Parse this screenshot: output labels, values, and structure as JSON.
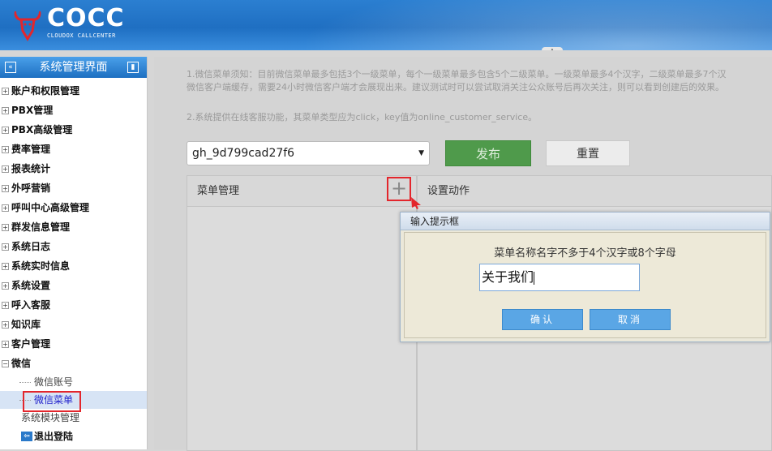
{
  "brand": {
    "logo_text": "COCC",
    "logo_sub": "CLOUDOX CALLCENTER"
  },
  "sidebar": {
    "title": "系统管理界面",
    "items": [
      {
        "label": "账户和权限管理"
      },
      {
        "label": "PBX管理"
      },
      {
        "label": "PBX高级管理"
      },
      {
        "label": "费率管理"
      },
      {
        "label": "报表统计"
      },
      {
        "label": "外呼营销"
      },
      {
        "label": "呼叫中心高级管理"
      },
      {
        "label": "群发信息管理"
      },
      {
        "label": "系统日志"
      },
      {
        "label": "系统实时信息"
      },
      {
        "label": "系统设置"
      },
      {
        "label": "呼入客服"
      },
      {
        "label": "知识库"
      },
      {
        "label": "客户管理"
      },
      {
        "label": "微信"
      }
    ],
    "wechat_children": [
      {
        "label": "微信账号"
      },
      {
        "label": "微信菜单"
      }
    ],
    "extra": "系统模块管理",
    "logout": "退出登陆"
  },
  "main": {
    "note1_line1": "1.微信菜单须知：目前微信菜单最多包括3个一级菜单，每个一级菜单最多包含5个二级菜单。一级菜单最多4个汉字，二级菜单最多7个汉",
    "note1_line2": "微信客户端缓存，需要24小时微信客户端才会展现出来。建议测试时可以尝试取消关注公众账号后再次关注，则可以看到创建后的效果。",
    "note2": "2.系统提供在线客服功能，其菜单类型应为click，key值为online_customer_service。",
    "account_select": "gh_9d799cad27f6",
    "publish_label": "发布",
    "reset_label": "重置",
    "menu_panel_title": "菜单管理",
    "action_panel_title": "设置动作",
    "add_symbol": "+"
  },
  "dialog": {
    "title": "输入提示框",
    "hint": "菜单名称名字不多于4个汉字或8个字母",
    "input_value": "关于我们",
    "ok_label": "确认",
    "cancel_label": "取消"
  }
}
